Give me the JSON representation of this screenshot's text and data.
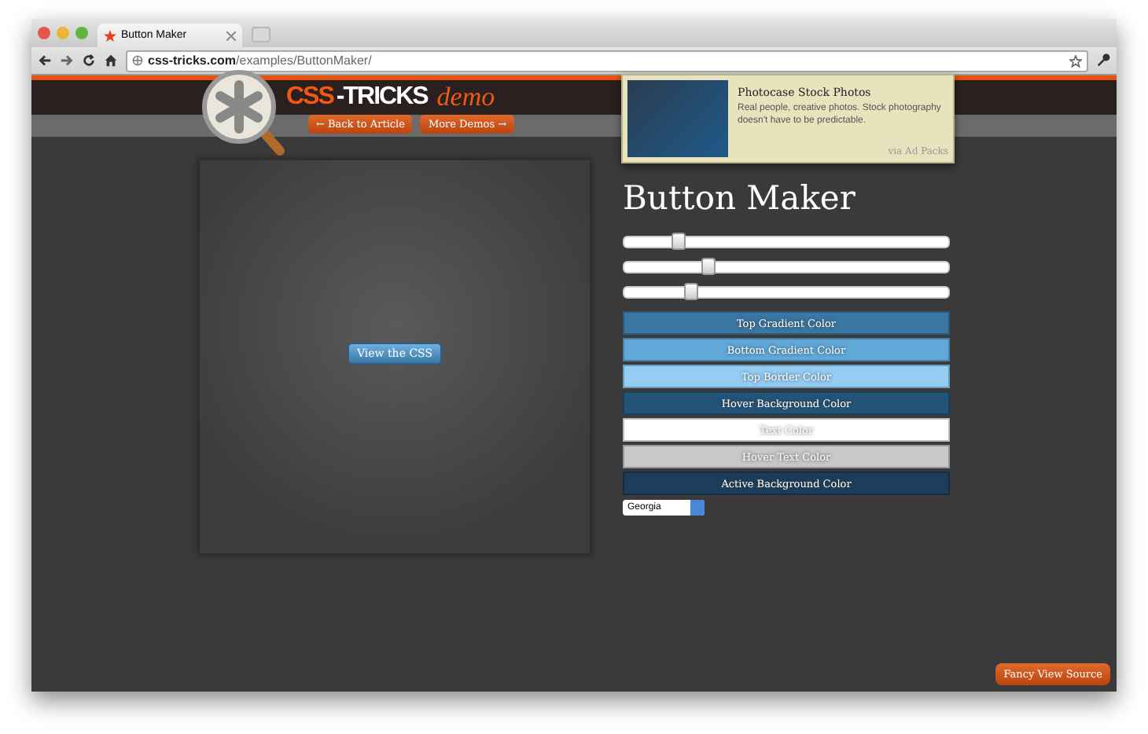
{
  "browser": {
    "tab_title": "Button Maker",
    "url_host": "css-tricks.com",
    "url_path": "/examples/ButtonMaker/"
  },
  "header": {
    "logo_main": "CSS",
    "logo_rest": "-TRICKS",
    "logo_tag": "demo",
    "nav": [
      "← Back to Article",
      "More Demos →"
    ]
  },
  "ad": {
    "title": "Photocase Stock Photos",
    "text": "Real people, creative photos. Stock photography doesn't have to be predictable.",
    "credit": "via Ad Packs"
  },
  "preview": {
    "button": "View the CSS"
  },
  "title": "Button Maker",
  "sliders": [
    {
      "level": 0.17
    },
    {
      "level": 0.26
    },
    {
      "level": 0.21
    }
  ],
  "swatches": [
    {
      "label": "Top Gradient Color",
      "color": "#3a77a3"
    },
    {
      "label": "Bottom Gradient Color",
      "color": "#5fa8d8"
    },
    {
      "label": "Top Border Color",
      "color": "#93cdf4"
    },
    {
      "label": "Hover Background Color",
      "color": "#245478"
    },
    {
      "label": "Text Color",
      "color": "#ffffff"
    },
    {
      "label": "Hover Text Color",
      "color": "#c8c8c8"
    },
    {
      "label": "Active Background Color",
      "color": "#1c3e5a"
    }
  ],
  "font_select": {
    "value": "Georgia"
  },
  "footer_button": "Fancy View Source"
}
